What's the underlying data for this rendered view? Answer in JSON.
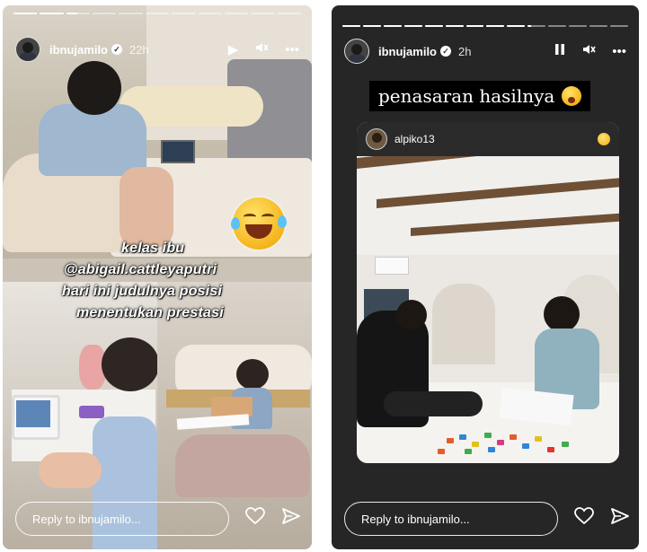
{
  "stories": [
    {
      "progress": [
        1,
        1,
        0.45,
        0,
        0,
        0,
        0,
        0,
        0,
        0,
        0
      ],
      "user": {
        "username": "ibnujamilo",
        "time": "22h"
      },
      "controls": {
        "play_icon": "play-icon",
        "mute_icon": "mute-icon",
        "more_icon": "more-icon"
      },
      "caption": {
        "line1": "kelas ibu",
        "line2": "@abigail.cattleyaputri",
        "line3": "hari ini judulnya posisi",
        "line4": "menentukan prestasi"
      },
      "sticker_icon": "rofl-emoji-icon",
      "reply_placeholder": "Reply to ibnujamilo...",
      "footer_icons": [
        "heart-icon",
        "send-icon"
      ]
    },
    {
      "progress": [
        1,
        1,
        1,
        1,
        1,
        1,
        1,
        1,
        1,
        0.2,
        0,
        0,
        0,
        0
      ],
      "user": {
        "username": "ibnujamilo",
        "time": "2h"
      },
      "controls": {
        "pause_icon": "pause-icon",
        "mute_icon": "mute-icon",
        "more_icon": "more-icon"
      },
      "title": "penasaran hasilnya",
      "title_icon": "astonished-emoji-icon",
      "shared_post": {
        "username": "alpiko13",
        "icon": "hugging-emoji-icon"
      },
      "reply_placeholder": "Reply to ibnujamilo...",
      "footer_icons": [
        "heart-icon",
        "send-icon"
      ]
    }
  ],
  "colors": {
    "text": "#ffffff",
    "panel_dark": "#262626"
  }
}
